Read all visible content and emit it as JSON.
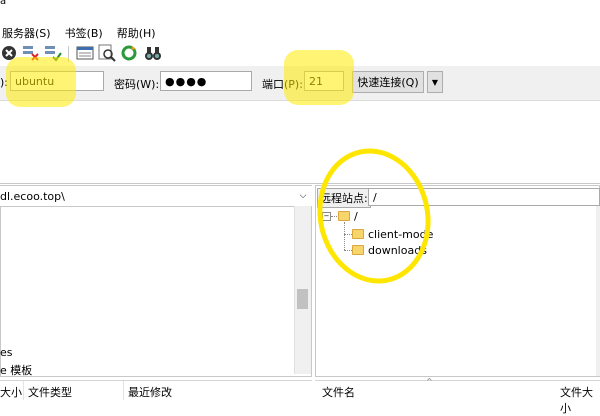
{
  "window": {
    "title_fragment": "a"
  },
  "menu": {
    "items": [
      "服务器(S)",
      "书签(B)",
      "帮助(H)"
    ]
  },
  "toolbar": {
    "icons": [
      "stop-icon",
      "disconnect-icon",
      "reconnect-icon",
      "filter-icon",
      "search-icon",
      "refresh-icon",
      "binoculars-icon"
    ]
  },
  "quickconnect": {
    "user_label": "):",
    "user_value": "ubuntu",
    "password_label": "密码(W):",
    "password_value": "●●●●",
    "port_label": "端口(P):",
    "port_value": "21",
    "connect_button": "快速连接(Q)",
    "dropdown_arrow": "▼"
  },
  "local": {
    "path": "dl.ecoo.top\\",
    "visible_fragments": [
      "es",
      "e 模板"
    ]
  },
  "remote": {
    "site_label": "远程站点:",
    "path": "/",
    "tree": {
      "root": "/",
      "children": [
        "client-mode",
        "downloads"
      ]
    }
  },
  "local_columns": [
    "大小",
    "文件类型",
    "最近修改"
  ],
  "remote_columns": [
    "文件名",
    "文件大小"
  ],
  "colors": {
    "highlight": "#ffe600",
    "toolbar_bg": "#f0f0f0"
  }
}
